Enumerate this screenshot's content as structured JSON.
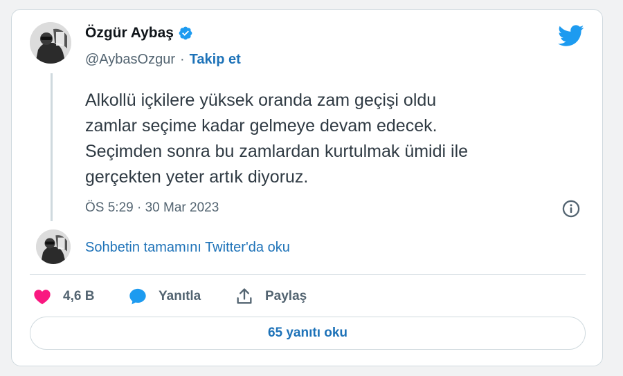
{
  "author": {
    "name": "Özgür Aybaş",
    "handle": "@AybasOzgur",
    "separator": "·",
    "follow_label": "Takip et",
    "verified_icon": "verified-badge-icon"
  },
  "tweet": {
    "lines": [
      "Alkollü içkilere yüksek oranda zam geçişi oldu",
      "zamlar seçime kadar gelmeye devam edecek.",
      "Seçimden sonra bu zamlardan kurtulmak ümidi ile",
      "gerçekten yeter artık diyoruz."
    ],
    "timestamp": "ÖS 5:29 · 30 Mar 2023"
  },
  "conversation": {
    "link_label": "Sohbetin tamamını Twitter'da oku"
  },
  "actions": {
    "like_count": "4,6 B",
    "reply_label": "Yanıtla",
    "share_label": "Paylaş"
  },
  "read_replies_label": "65 yanıtı oku",
  "colors": {
    "accent": "#1d9bf0",
    "link": "#1d72b8",
    "like": "#f91880",
    "muted": "#536471"
  }
}
